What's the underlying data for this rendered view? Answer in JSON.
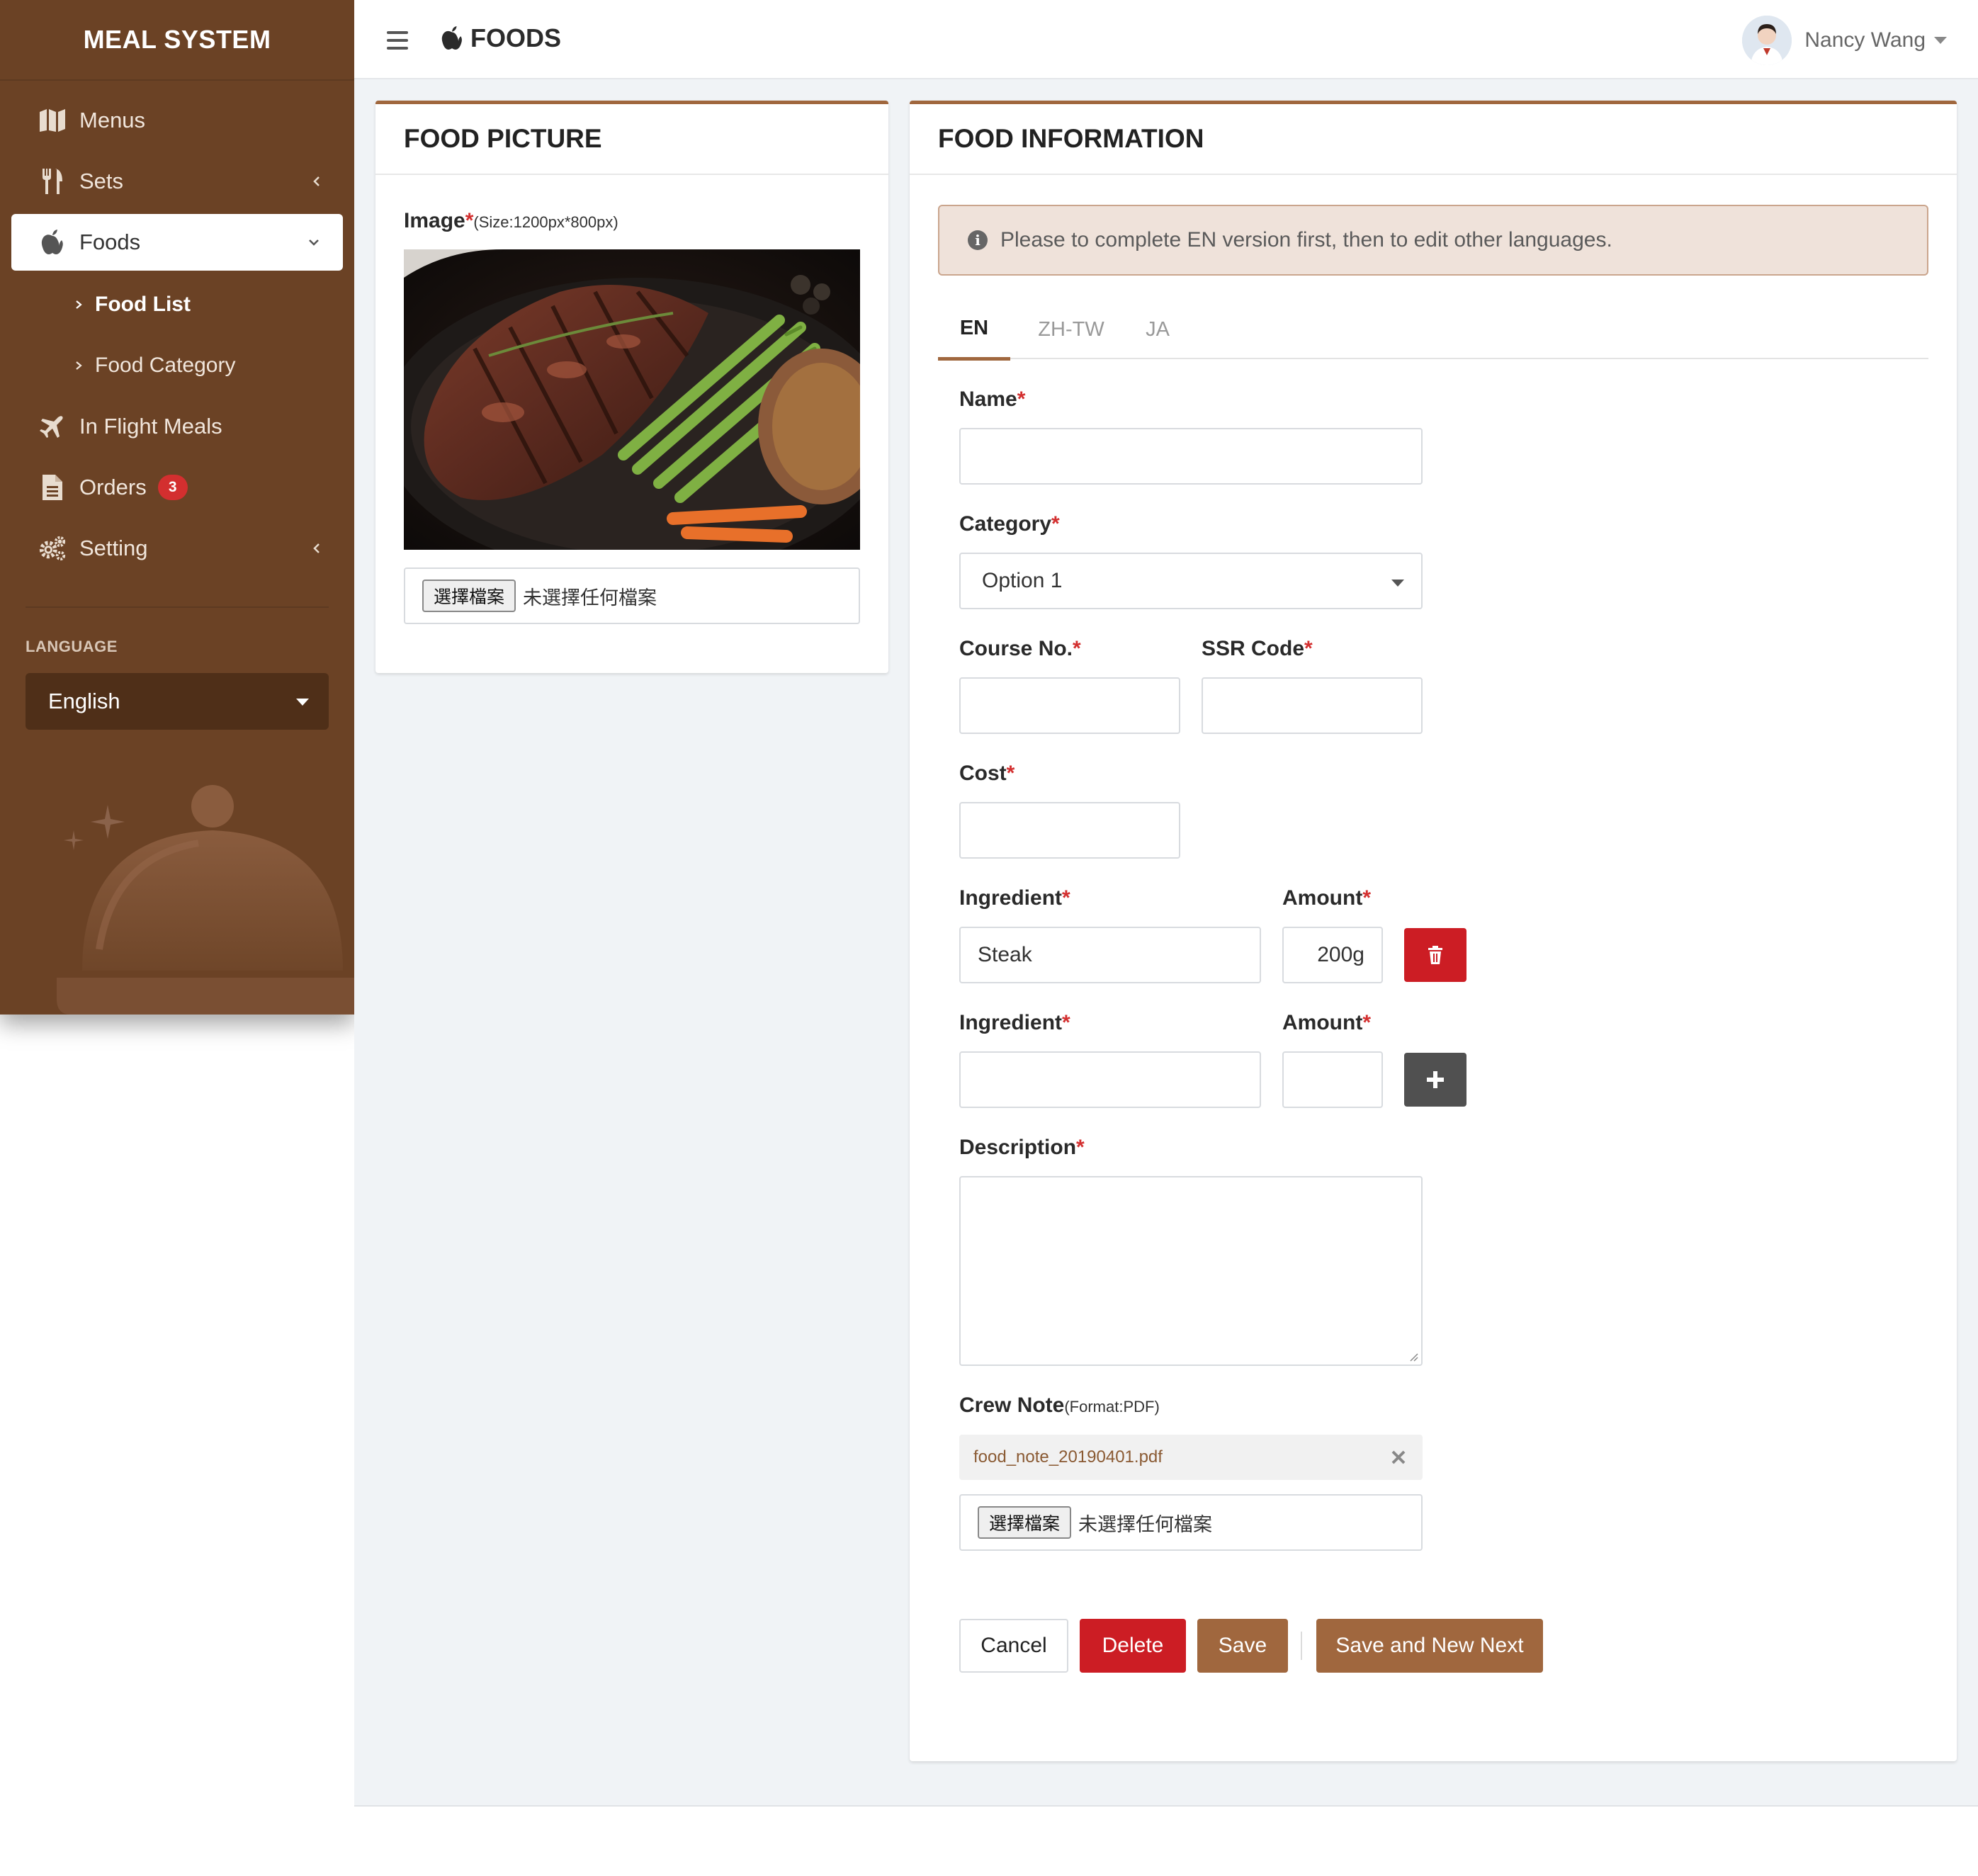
{
  "sidebar": {
    "brand": "MEAL SYSTEM",
    "items": [
      {
        "label": "Menus",
        "icon": "map-icon"
      },
      {
        "label": "Sets",
        "icon": "utensils-icon"
      },
      {
        "label": "Foods",
        "icon": "apple-icon"
      },
      {
        "label": "In Flight Meals",
        "icon": "plane-icon"
      },
      {
        "label": "Orders",
        "icon": "document-icon",
        "badge": "3"
      },
      {
        "label": "Setting",
        "icon": "gears-icon"
      }
    ],
    "sub_items": [
      {
        "label": "Food List",
        "current": true
      },
      {
        "label": "Food Category",
        "current": false
      }
    ],
    "language_heading": "LANGUAGE",
    "language_value": "English"
  },
  "header": {
    "page_title": "FOODS",
    "user_name": "Nancy Wang"
  },
  "picture_card": {
    "title": "FOOD PICTURE",
    "image_label": "Image",
    "image_hint": "(Size:1200px*800px)",
    "file_button": "選擇檔案",
    "file_status": "未選擇任何檔案"
  },
  "info_card": {
    "title": "FOOD INFORMATION",
    "alert": "Please to complete EN version first, then to edit other languages.",
    "tabs": [
      {
        "label": "EN",
        "active": true
      },
      {
        "label": "ZH-TW",
        "active": false
      },
      {
        "label": "JA",
        "active": false
      }
    ],
    "name_label": "Name",
    "name_value": "",
    "category_label": "Category",
    "category_value": "Option 1",
    "course_label": "Course No.",
    "ssr_label": "SSR Code",
    "cost_label": "Cost",
    "ingredients": [
      {
        "label": "Ingredient",
        "amount_label": "Amount",
        "value": "Steak",
        "amount": "200g",
        "action": "trash-icon"
      },
      {
        "label": "Ingredient",
        "amount_label": "Amount",
        "value": "",
        "amount": "",
        "action": "plus-icon"
      }
    ],
    "description_label": "Description",
    "crew_note_label": "Crew Note",
    "crew_note_hint": "(Format:PDF)",
    "attachment": "food_note_20190401.pdf",
    "file_button": "選擇檔案",
    "file_status": "未選擇任何檔案",
    "buttons": {
      "cancel": "Cancel",
      "delete": "Delete",
      "save": "Save",
      "save_new": "Save and New Next"
    }
  },
  "colors": {
    "sidebar": "#6b4225",
    "accent": "#a0673e",
    "danger": "#cc1d24",
    "badge": "#d32f2f"
  }
}
